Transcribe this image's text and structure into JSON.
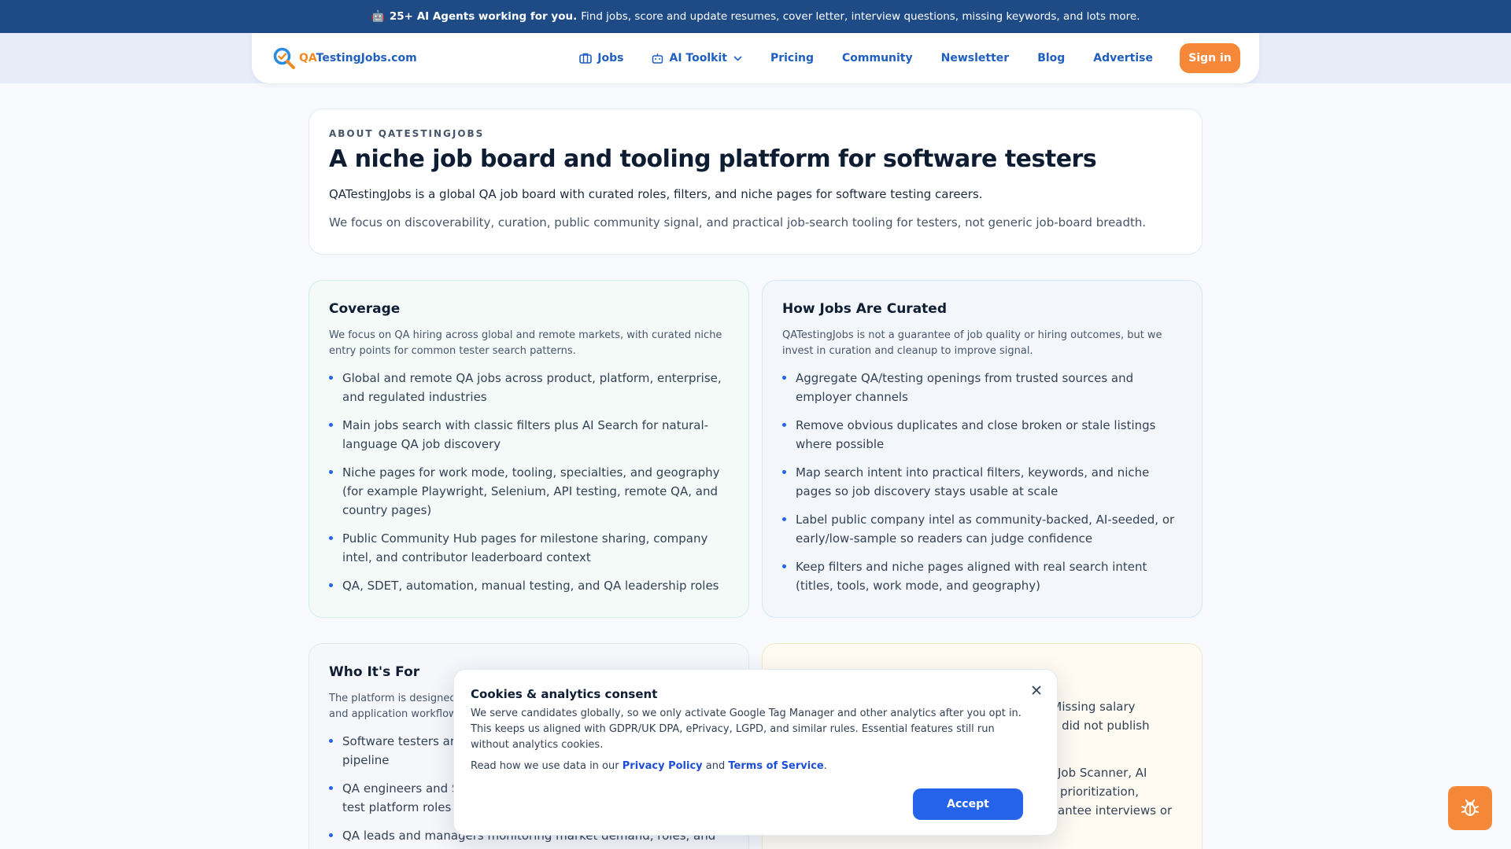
{
  "topbar": {
    "robot_glyph": "🤖",
    "highlight": "25+ AI Agents working for you.",
    "text": "Find jobs, score and update resumes, cover letter, interview questions, missing keywords, and lots more."
  },
  "brand": {
    "logo_prefix": "QA",
    "logo_suffix": "TestingJobs.com",
    "orange": "#f6883a",
    "blue": "#1f5fbf"
  },
  "nav": {
    "items": [
      {
        "label": "Jobs",
        "icon": "briefcase-icon"
      },
      {
        "label": "AI Toolkit",
        "icon": "robot-icon"
      },
      {
        "label": "Pricing"
      },
      {
        "label": "Community"
      },
      {
        "label": "Newsletter"
      },
      {
        "label": "Blog"
      },
      {
        "label": "Advertise"
      }
    ],
    "signin": "Sign in"
  },
  "about": {
    "eyebrow": "ABOUT QATESTINGJOBS",
    "title": "A niche job board and tooling platform for software testers",
    "p1": "QATestingJobs is a global QA job board with curated roles, filters, and niche pages for software testing careers.",
    "p2": "We focus on discoverability, curation, public community signal, and practical job-search tooling for testers, not generic job-board breadth."
  },
  "coverage": {
    "title": "Coverage",
    "intro": "We focus on QA hiring across global and remote markets, with curated niche entry points for common tester search patterns.",
    "items": [
      "Global and remote QA jobs across product, platform, enterprise, and regulated industries",
      "Main jobs search with classic filters plus AI Search for natural-language QA job discovery",
      "Niche pages for work mode, tooling, specialties, and geography (for example Playwright, Selenium, API testing, remote QA, and country pages)",
      "Public Community Hub pages for milestone sharing, company intel, and contributor leaderboard context",
      "QA, SDET, automation, manual testing, and QA leadership roles"
    ]
  },
  "curated": {
    "title": "How Jobs Are Curated",
    "intro": "QATestingJobs is not a guarantee of job quality or hiring outcomes, but we invest in curation and cleanup to improve signal.",
    "items": [
      "Aggregate QA/testing openings from trusted sources and employer channels",
      "Remove obvious duplicates and close broken or stale listings where possible",
      "Map search intent into practical filters, keywords, and niche pages so job discovery stays usable at scale",
      "Label public company intel as community-backed, AI-seeded, or early/low-sample so readers can judge confidence",
      "Keep filters and niche pages aligned with real search intent (titles, tools, work mode, and geography)"
    ]
  },
  "who": {
    "title": "Who It's For",
    "intro_line1": "The platform is designed",
    "intro_line2": "and application workflow",
    "items": [
      {
        "l1": "Software testers ar",
        "l2": "pipeline"
      },
      {
        "l1": "QA engineers and S",
        "l2": "test platform roles"
      },
      {
        "l1": "QA leads and managers monitoring market demand, roles, and",
        "l2": ""
      }
    ]
  },
  "fourth": {
    "frag1": "t. Missing salary",
    "frag2": "rce did not publish",
    "frag3": "Job Scanner, AI",
    "frag4": "prioritization,",
    "frag5": "antee interviews or"
  },
  "consent": {
    "title": "Cookies & analytics consent",
    "body": "We serve candidates globally, so we only activate Google Tag Manager and other analytics after you opt in. This keeps us aligned with GDPR/UK DPA, ePrivacy, LGPD, and similar rules. Essential features still run without analytics cookies.",
    "read_prefix": "Read how we use data in our",
    "privacy": "Privacy Policy",
    "and": "and",
    "terms": "Terms of Service",
    "period": ".",
    "accept": "Accept"
  }
}
